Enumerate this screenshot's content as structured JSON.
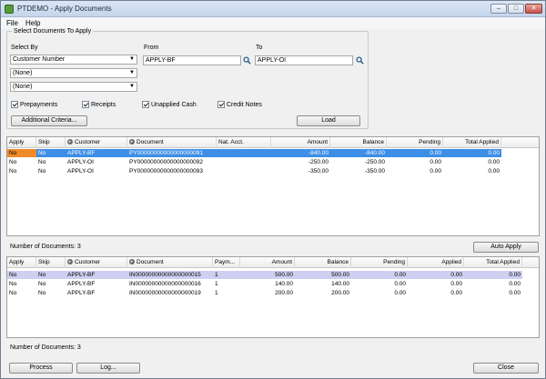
{
  "window": {
    "title": "PTDEMO - Apply Documents",
    "min": "–",
    "max": "□",
    "close": "✕"
  },
  "menu": {
    "file": "File",
    "help": "Help"
  },
  "group": {
    "title": "Select Documents To Apply",
    "select_by_label": "Select By",
    "select1": "Customer Number",
    "select2": "(None)",
    "select3": "(None)",
    "from_label": "From",
    "from_value": "APPLY-BF",
    "to_label": "To",
    "to_value": "APPLY-OI",
    "checks": [
      "Prepayments",
      "Receipts",
      "Unapplied Cash",
      "Credit Notes"
    ],
    "additional_criteria": "Additional Criteria...",
    "load": "Load"
  },
  "top_grid": {
    "headers": [
      "Apply",
      "Skip",
      "Customer",
      "Document",
      "Nat. Acct.",
      "Amount",
      "Balance",
      "Pending",
      "Total Applied"
    ],
    "rows": [
      [
        "No",
        "No",
        "APPLY-BF",
        "PY00000000000000000091",
        "",
        "-840.00",
        "-840.00",
        "0.00",
        "0.00"
      ],
      [
        "No",
        "No",
        "APPLY-OI",
        "PY00000000000000000092",
        "",
        "-250.00",
        "-250.00",
        "0.00",
        "0.00"
      ],
      [
        "No",
        "No",
        "APPLY-OI",
        "PY00000000000000000093",
        "",
        "-350.00",
        "-350.00",
        "0.00",
        "0.00"
      ]
    ],
    "count_label": "Number of Documents: 3",
    "auto_apply": "Auto Apply"
  },
  "bottom_grid": {
    "headers": [
      "Apply",
      "Skip",
      "Customer",
      "Document",
      "Paym...",
      "Amount",
      "Balance",
      "Pending",
      "Applied",
      "Total Applied"
    ],
    "rows": [
      [
        "No",
        "No",
        "APPLY-BF",
        "IN00000000000000000015",
        "1",
        "500.00",
        "500.00",
        "0.00",
        "0.00",
        "0.00"
      ],
      [
        "No",
        "No",
        "APPLY-BF",
        "IN00000000000000000016",
        "1",
        "140.00",
        "140.00",
        "0.00",
        "0.00",
        "0.00"
      ],
      [
        "No",
        "No",
        "APPLY-BF",
        "IN00000000000000000019",
        "1",
        "200.00",
        "200.00",
        "0.00",
        "0.00",
        "0.00"
      ]
    ],
    "count_label": "Number of Documents: 3"
  },
  "footer": {
    "process": "Process",
    "log": "Log...",
    "close": "Close"
  }
}
